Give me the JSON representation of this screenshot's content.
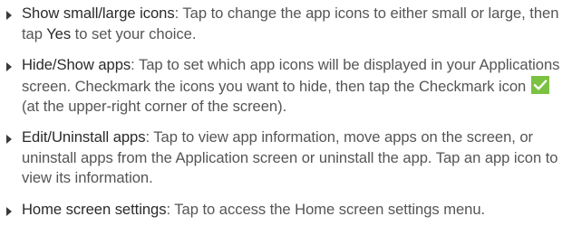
{
  "items": [
    {
      "term": "Show small/large icons",
      "text_before": ": Tap to change the app icons to either small or large, then tap ",
      "strong": "Yes",
      "text_after": " to set your choice."
    },
    {
      "term": "Hide/Show apps",
      "text_before": ": Tap to set which app icons will be displayed in your Applications screen. Checkmark the icons you want to hide, then tap the Checkmark icon",
      "icon": "checkmark-icon",
      "text_after": " (at the upper-right corner of the screen)."
    },
    {
      "term": "Edit/Uninstall apps",
      "text": ": Tap to view app information, move apps on the screen, or uninstall apps from the Application screen or uninstall the app. Tap an app icon to view its information."
    },
    {
      "term": "Home screen settings",
      "text": ": Tap to access the Home screen settings menu."
    }
  ],
  "colors": {
    "checkmark_bg": "#7bc242",
    "text": "#555555",
    "term": "#2a2a2a"
  }
}
